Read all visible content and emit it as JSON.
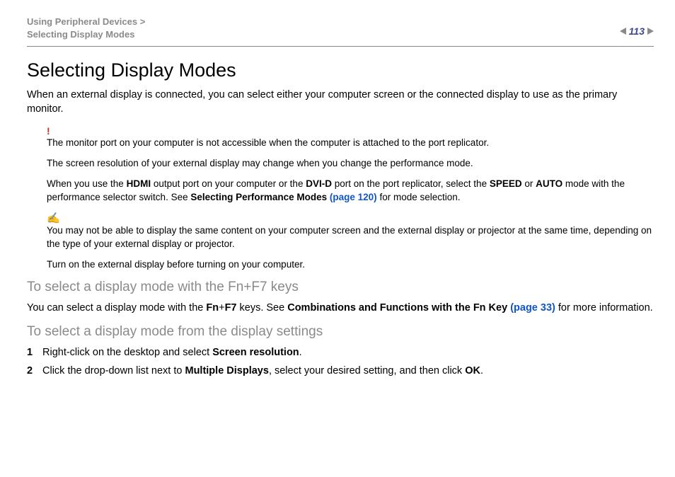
{
  "header": {
    "breadcrumb_top": "Using Peripheral Devices",
    "breadcrumb_sep": ">",
    "breadcrumb_bottom": "Selecting Display Modes",
    "page_number": "113"
  },
  "title": "Selecting Display Modes",
  "intro": "When an external display is connected, you can select either your computer screen or the connected display to use as the primary monitor.",
  "warning": {
    "icon": "!",
    "p1": "The monitor port on your computer is not accessible when the computer is attached to the port replicator.",
    "p2": "The screen resolution of your external display may change when you change the performance mode.",
    "p3_a": "When you use the ",
    "p3_hdmi": "HDMI",
    "p3_b": " output port on your computer or the ",
    "p3_dvid": "DVI-D",
    "p3_c": " port on the port replicator, select the ",
    "p3_speed": "SPEED",
    "p3_d": " or ",
    "p3_auto": "AUTO",
    "p3_e": " mode with the performance selector switch. See ",
    "p3_link_label": "Selecting Performance Modes ",
    "p3_link_page": "(page 120)",
    "p3_f": " for mode selection."
  },
  "info": {
    "icon": "✍",
    "p1": "You may not be able to display the same content on your computer screen and the external display or projector at the same time, depending on the type of your external display or projector.",
    "p2": "Turn on the external display before turning on your computer."
  },
  "section_fn": {
    "heading": "To select a display mode with the Fn+F7 keys",
    "text_a": "You can select a display mode with the ",
    "fn": "Fn",
    "plus": "+",
    "f7": "F7",
    "text_b": " keys. See ",
    "link_label": "Combinations and Functions with the Fn Key ",
    "link_page": "(page 33)",
    "text_c": " for more information."
  },
  "section_settings": {
    "heading": "To select a display mode from the display settings",
    "step1_num": "1",
    "step1_a": "Right-click on the desktop and select ",
    "step1_b": "Screen resolution",
    "step1_c": ".",
    "step2_num": "2",
    "step2_a": "Click the drop-down list next to ",
    "step2_b": "Multiple Displays",
    "step2_c": ", select your desired setting, and then click ",
    "step2_d": "OK",
    "step2_e": "."
  }
}
